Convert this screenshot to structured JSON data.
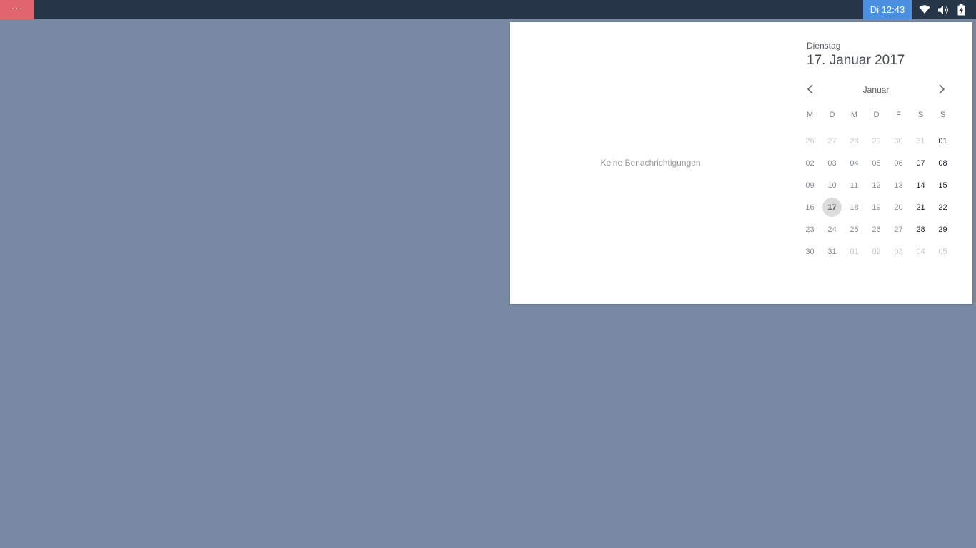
{
  "panel": {
    "menu_label": "···",
    "clock": "Di 12:43",
    "icons": [
      "wifi-icon",
      "volume-icon",
      "battery-icon"
    ]
  },
  "notifications": {
    "empty_text": "Keine Benachrichtigungen"
  },
  "calendar": {
    "weekday": "Dienstag",
    "full_date": "17. Januar 2017",
    "month": "Januar",
    "day_headers": [
      "M",
      "D",
      "M",
      "D",
      "F",
      "S",
      "S"
    ],
    "weeks": [
      [
        "26",
        "27",
        "28",
        "29",
        "30",
        "31",
        "01"
      ],
      [
        "02",
        "03",
        "04",
        "05",
        "06",
        "07",
        "08"
      ],
      [
        "09",
        "10",
        "11",
        "12",
        "13",
        "14",
        "15"
      ],
      [
        "16",
        "17",
        "18",
        "19",
        "20",
        "21",
        "22"
      ],
      [
        "23",
        "24",
        "25",
        "26",
        "27",
        "28",
        "29"
      ],
      [
        "30",
        "31",
        "01",
        "02",
        "03",
        "04",
        "05"
      ]
    ],
    "today": "17"
  },
  "colors": {
    "desktop": "#7a89a3",
    "panel": "#273548",
    "menu_button": "#e0656c",
    "clock_highlight": "#4a8fe0"
  }
}
